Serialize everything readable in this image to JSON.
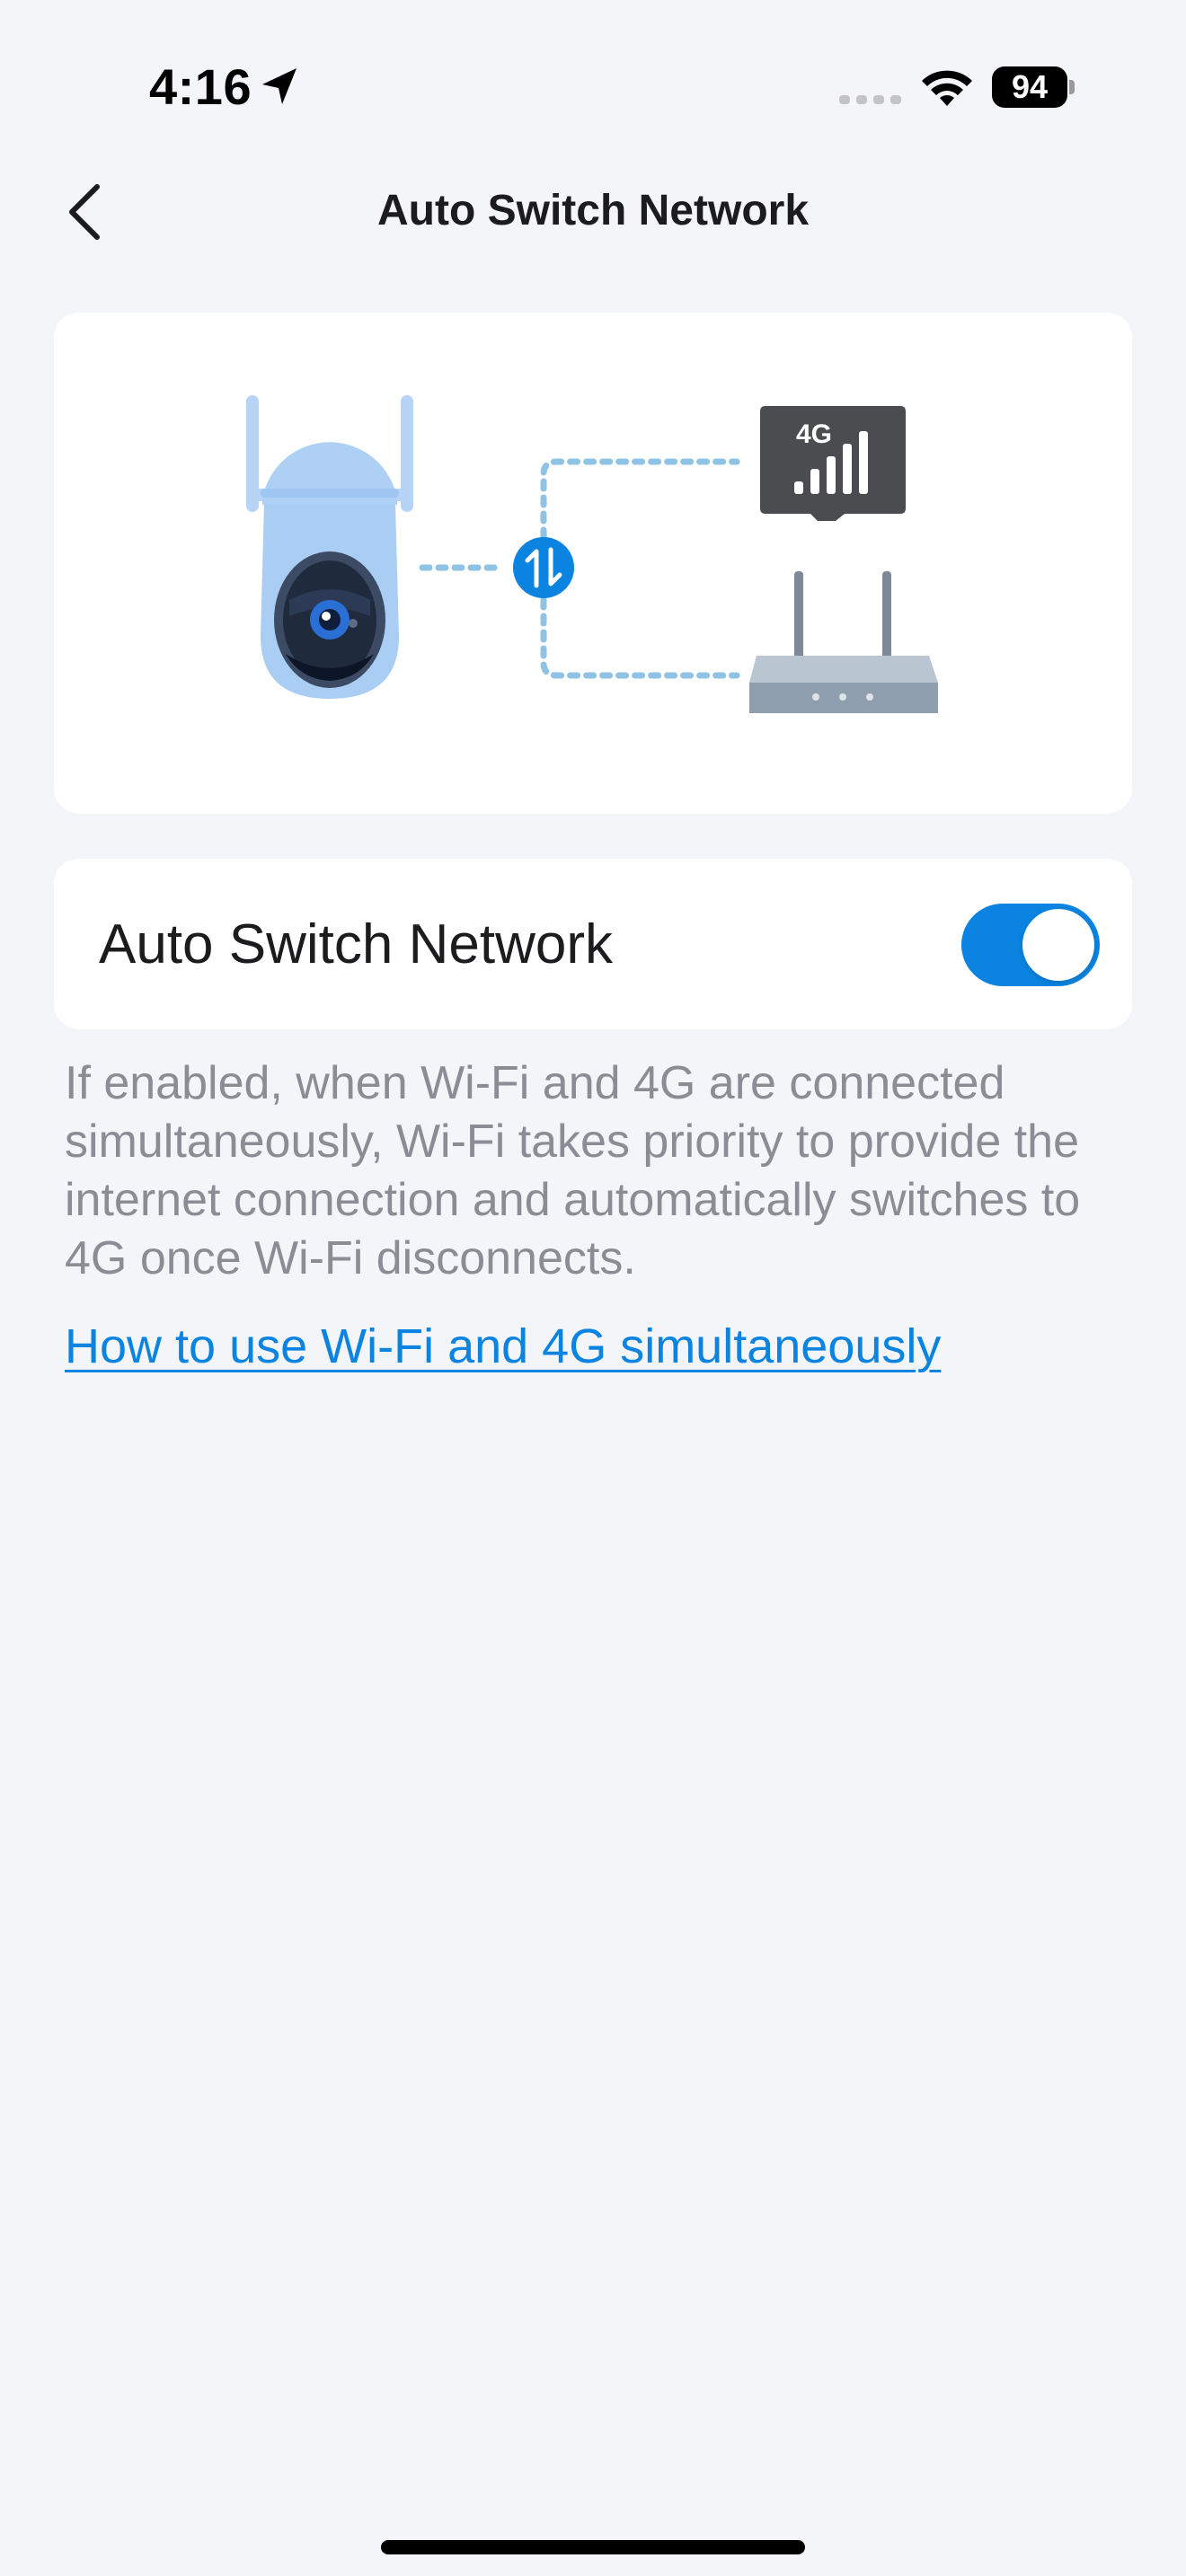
{
  "status_bar": {
    "time": "4:16",
    "battery_level": "94",
    "icons": [
      "location-arrow-icon",
      "signal-dots-icon",
      "wifi-icon",
      "battery-icon"
    ]
  },
  "nav": {
    "title": "Auto Switch Network",
    "back_icon": "chevron-left-icon"
  },
  "illustration": {
    "badge_text": "4G",
    "icons": [
      "camera-icon",
      "switch-arrows-icon",
      "sim-card-4g-icon",
      "router-icon"
    ]
  },
  "setting": {
    "label": "Auto Switch Network",
    "enabled": true
  },
  "description": "If enabled, when Wi-Fi and 4G are connected simultaneously, Wi-Fi takes priority to provide the internet connection and automatically switches to 4G once Wi-Fi disconnects.",
  "help_link": "How to use Wi-Fi and 4G simultaneously",
  "colors": {
    "background": "#f3f5f9",
    "card": "#ffffff",
    "accent": "#0a84e0",
    "secondary_text": "#8a8d93"
  }
}
